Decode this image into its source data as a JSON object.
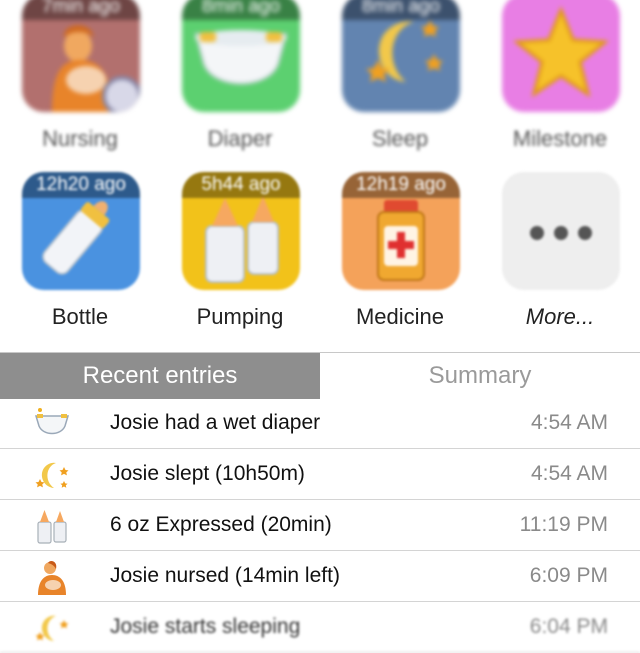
{
  "tiles": [
    {
      "label": "Nursing",
      "ago": "7min ago",
      "bg": "#b2706e"
    },
    {
      "label": "Diaper",
      "ago": "8min ago",
      "bg": "#5cd070"
    },
    {
      "label": "Sleep",
      "ago": "8min ago",
      "bg": "#6284b0"
    },
    {
      "label": "Milestone",
      "ago": "",
      "bg": "#e87ee4"
    },
    {
      "label": "Bottle",
      "ago": "12h20 ago",
      "bg": "#4a92e0"
    },
    {
      "label": "Pumping",
      "ago": "5h44 ago",
      "bg": "#f2c21a"
    },
    {
      "label": "Medicine",
      "ago": "12h19 ago",
      "bg": "#f4a25a"
    },
    {
      "label": "More...",
      "ago": "",
      "bg": "#eeeeee"
    }
  ],
  "tabs": {
    "active": "Recent entries",
    "inactive": "Summary"
  },
  "entries": [
    {
      "text": "Josie had a wet diaper",
      "time": "4:54 AM",
      "icon": "diaper-icon"
    },
    {
      "text": "Josie slept (10h50m)",
      "time": "4:54 AM",
      "icon": "sleep-moon-icon"
    },
    {
      "text": "6 oz Expressed (20min)",
      "time": "11:19 PM",
      "icon": "pumping-bottles-icon"
    },
    {
      "text": "Josie nursed (14min left)",
      "time": "6:09 PM",
      "icon": "nursing-icon"
    },
    {
      "text": "Josie starts sleeping",
      "time": "6:04 PM",
      "icon": "sleep-moon-icon"
    }
  ]
}
